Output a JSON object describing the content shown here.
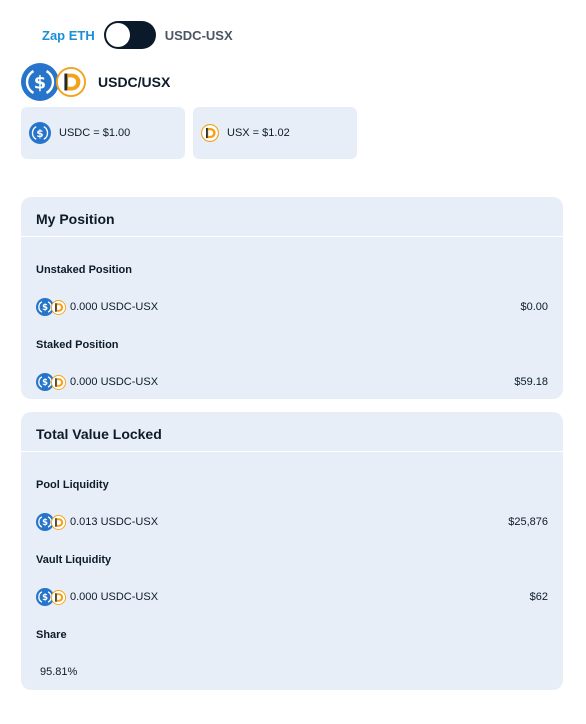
{
  "toggle": {
    "left_label": "Zap ETH",
    "right_label": "USDC-USX",
    "on": false
  },
  "pool": {
    "title": "USDC/USX"
  },
  "prices": [
    {
      "token": "USDC",
      "text": "USDC = $1.00",
      "icon": "usdc-icon"
    },
    {
      "token": "USX",
      "text": "USX = $1.02",
      "icon": "usx-icon"
    }
  ],
  "my_position": {
    "title": "My Position",
    "unstaked": {
      "label": "Unstaked Position",
      "amount": "0.000 USDC-USX",
      "usd": "$0.00"
    },
    "staked": {
      "label": "Staked Position",
      "amount": "0.000 USDC-USX",
      "usd": "$59.18"
    }
  },
  "tvl": {
    "title": "Total Value Locked",
    "pool_liquidity": {
      "label": "Pool Liquidity",
      "amount": "0.013 USDC-USX",
      "usd": "$25,876"
    },
    "vault_liquidity": {
      "label": "Vault Liquidity",
      "amount": "0.000 USDC-USX",
      "usd": "$62"
    },
    "share": {
      "label": "Share",
      "value": "95.81%"
    }
  },
  "colors": {
    "usdc_blue": "#2775ca",
    "usx_orange": "#f4a21b",
    "panel_bg": "#e7eef7",
    "toggle_dark": "#0b1a2b",
    "zap_blue": "#1a8fd8"
  }
}
